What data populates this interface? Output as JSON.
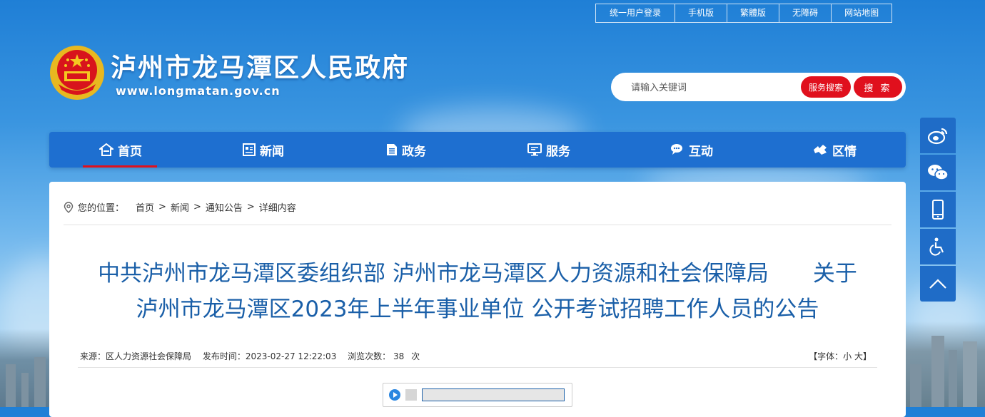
{
  "top_links": [
    "统一用户登录",
    "手机版",
    "繁體版",
    "无障碍",
    "网站地图"
  ],
  "header": {
    "title": "泸州市龙马潭区人民政府",
    "url": "www.longmatan.gov.cn"
  },
  "search": {
    "placeholder": "请输入关键词",
    "service_button": "服务搜索",
    "search_button": "搜 索"
  },
  "nav": [
    {
      "label": "首页",
      "icon": "home-icon",
      "active": true
    },
    {
      "label": "新闻",
      "icon": "news-icon",
      "active": false
    },
    {
      "label": "政务",
      "icon": "document-icon",
      "active": false
    },
    {
      "label": "服务",
      "icon": "service-icon",
      "active": false
    },
    {
      "label": "互动",
      "icon": "chat-icon",
      "active": false
    },
    {
      "label": "区情",
      "icon": "region-icon",
      "active": false
    }
  ],
  "sidebar": [
    "weibo-icon",
    "wechat-icon",
    "mobile-icon",
    "accessibility-icon",
    "back-to-top-icon"
  ],
  "breadcrumb": {
    "label": "您的位置：",
    "items": [
      "首页",
      "新闻",
      "通知公告",
      "详细内容"
    ]
  },
  "article": {
    "title_line1": "中共泸州市龙马潭区委组织部 泸州市龙马潭区人力资源和社会保障局　　关于",
    "title_line2": "泸州市龙马潭区2023年上半年事业单位 公开考试招聘工作人员的公告",
    "source_label": "来源：",
    "source": "区人力资源社会保障局",
    "published_label": "发布时间：",
    "published": "2023-02-27 12:22:03",
    "views_label": "浏览次数：",
    "views": "38",
    "views_unit": "次",
    "font_label": "【字体：",
    "font_small": "小",
    "font_large": "大",
    "font_close": "】"
  },
  "colors": {
    "nav_blue": "#1e6fd0",
    "accent_red": "#e0101d",
    "title_blue": "#1a5fa8"
  }
}
